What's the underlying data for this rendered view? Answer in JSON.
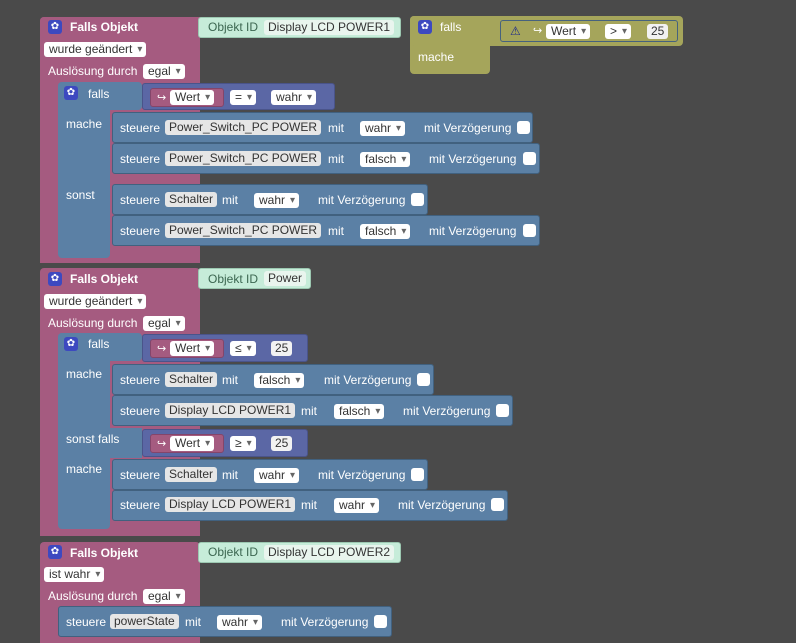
{
  "common": {
    "falls_objekt": "Falls Objekt",
    "objekt_id": "Objekt ID",
    "ausloesung": "Auslösung durch",
    "egal": "egal",
    "falls": "falls",
    "mache": "mache",
    "sonst": "sonst",
    "sonst_falls": "sonst falls",
    "steuere": "steuere",
    "mit": "mit",
    "mit_verzoegerung": "mit Verzögerung",
    "wert": "Wert",
    "wahr": "wahr",
    "falsch": "falsch",
    "icon_gear": "gear-icon",
    "icon_arrow": "return-arrow-icon",
    "icon_warning": "warning-icon"
  },
  "colors": {
    "trigger": "#a55b80",
    "control": "#5b80a5",
    "logic": "#5b67a5",
    "object": "#c6ecd9",
    "if_orphan": "#a5a55b",
    "workspace": "#4a4a4a"
  },
  "trigger1": {
    "object_id": "Display LCD POWER1",
    "condition": "wurde geändert",
    "compare_op": "=",
    "compare_value": "wahr",
    "actions": [
      {
        "target": "Power_Switch_PC POWER",
        "value": "wahr"
      },
      {
        "target": "Power_Switch_PC POWER",
        "value": "falsch"
      }
    ],
    "else_actions": [
      {
        "target": "Schalter",
        "value": "wahr"
      },
      {
        "target": "Power_Switch_PC POWER",
        "value": "falsch"
      }
    ]
  },
  "orphan_if": {
    "op": ">",
    "value": "25"
  },
  "trigger2": {
    "object_id": "Power",
    "condition": "wurde geändert",
    "op1": "≤",
    "val1": "25",
    "actions1": [
      {
        "target": "Schalter",
        "value": "falsch"
      },
      {
        "target": "Display LCD POWER1",
        "value": "falsch"
      }
    ],
    "op2": "≥",
    "val2": "25",
    "actions2": [
      {
        "target": "Schalter",
        "value": "wahr"
      },
      {
        "target": "Display LCD POWER1",
        "value": "wahr"
      }
    ]
  },
  "trigger3": {
    "object_id": "Display LCD POWER2",
    "condition": "ist wahr",
    "action": {
      "target": "powerState",
      "value": "wahr"
    }
  }
}
